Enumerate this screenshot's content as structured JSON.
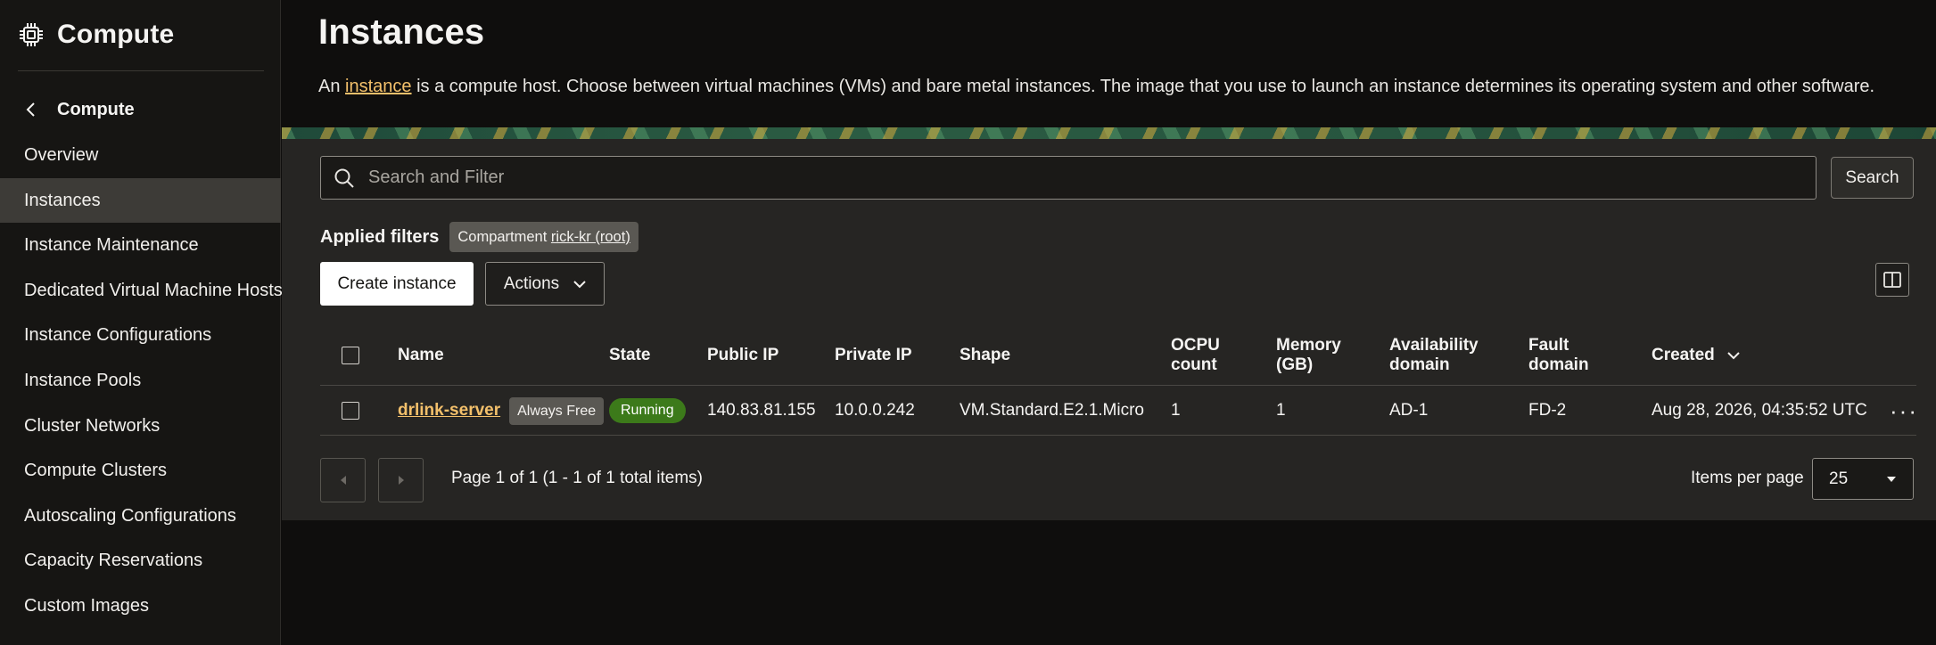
{
  "sidebar": {
    "title": "Compute",
    "back_label": "Compute",
    "items": [
      {
        "label": "Overview",
        "active": false
      },
      {
        "label": "Instances",
        "active": true
      },
      {
        "label": "Instance Maintenance",
        "active": false
      },
      {
        "label": "Dedicated Virtual Machine Hosts",
        "active": false
      },
      {
        "label": "Instance Configurations",
        "active": false
      },
      {
        "label": "Instance Pools",
        "active": false
      },
      {
        "label": "Cluster Networks",
        "active": false
      },
      {
        "label": "Compute Clusters",
        "active": false
      },
      {
        "label": "Autoscaling Configurations",
        "active": false
      },
      {
        "label": "Capacity Reservations",
        "active": false
      },
      {
        "label": "Custom Images",
        "active": false
      }
    ]
  },
  "main": {
    "title": "Instances",
    "description": {
      "prefix": "An ",
      "link": "instance",
      "suffix": " is a compute host. Choose between virtual machines (VMs) and bare metal instances. The image that you use to launch an instance determines its operating system and other software."
    }
  },
  "search": {
    "placeholder": "Search and Filter",
    "button_label": "Search"
  },
  "filters": {
    "label": "Applied filters",
    "chip_prefix": "Compartment ",
    "chip_value": "rick-kr (root)"
  },
  "toolbar": {
    "create_label": "Create instance",
    "actions_label": "Actions"
  },
  "table": {
    "columns": {
      "name": "Name",
      "state": "State",
      "public_ip": "Public IP",
      "private_ip": "Private IP",
      "shape": "Shape",
      "ocpu": "OCPU count",
      "memory": "Memory (GB)",
      "ad": "Availability domain",
      "fd": "Fault domain",
      "created": "Created"
    },
    "rows": [
      {
        "name": "drlink-server",
        "badge": "Always Free",
        "state": "Running",
        "public_ip": "140.83.81.155",
        "private_ip": "10.0.0.242",
        "shape": "VM.Standard.E2.1.Micro",
        "ocpu": "1",
        "memory": "1",
        "ad": "AD-1",
        "fd": "FD-2",
        "created": "Aug 28, 2026, 04:35:52 UTC"
      }
    ]
  },
  "pagination": {
    "status": "Page 1 of 1 (1 - 1 of 1 total items)",
    "items_per_page_label": "Items per page",
    "items_per_page": "25"
  },
  "colors": {
    "accent_link": "#f3c06b",
    "running": "#3c7a1a",
    "active_nav": "#3d3b37"
  }
}
